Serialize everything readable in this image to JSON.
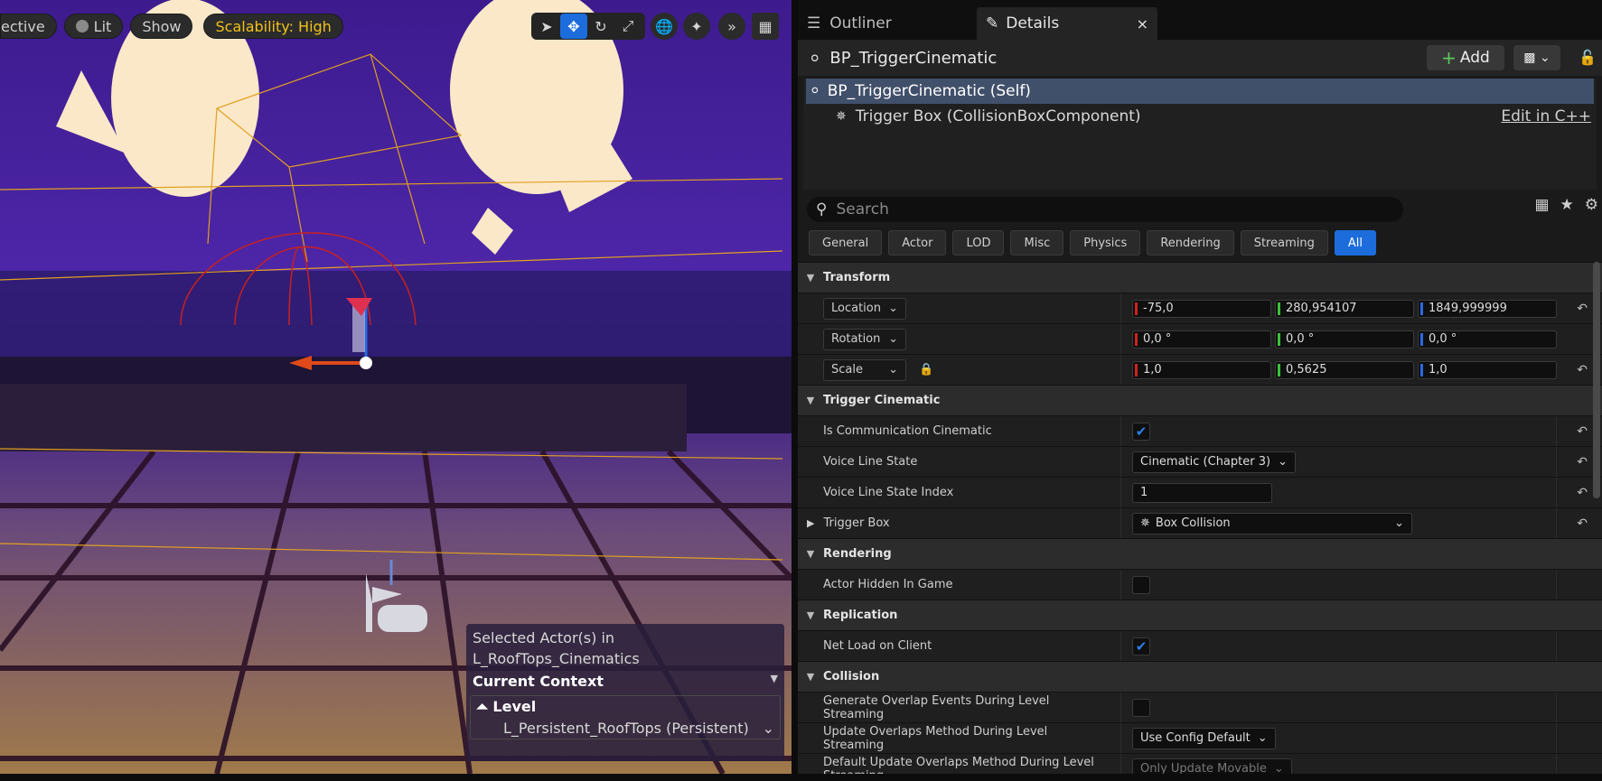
{
  "viewport": {
    "view_mode": "ective",
    "lit": "Lit",
    "show": "Show",
    "scalability": "Scalability: High",
    "tools": [
      "select-icon",
      "move-icon",
      "rotate-icon",
      "scale-icon"
    ],
    "context": {
      "selected_line1": "Selected Actor(s) in",
      "selected_line2": " L_RoofTops_Cinematics",
      "current_context": "Current Context",
      "level_label": "Level",
      "level_value": "L_Persistent_RoofTops (Persistent)"
    }
  },
  "tabs": {
    "outliner": "Outliner",
    "details": "Details"
  },
  "header": {
    "title": "BP_TriggerCinematic",
    "add_label": "Add"
  },
  "components": {
    "self": "BP_TriggerCinematic (Self)",
    "child": "Trigger Box (CollisionBoxComponent)",
    "edit_link": "Edit in C++"
  },
  "search": {
    "placeholder": "Search"
  },
  "filters": [
    "General",
    "Actor",
    "LOD",
    "Misc",
    "Physics",
    "Rendering",
    "Streaming",
    "All"
  ],
  "details": {
    "transform": {
      "title": "Transform",
      "location_label": "Location",
      "location": [
        "-75,0",
        "280,954107",
        "1849,999999"
      ],
      "rotation_label": "Rotation",
      "rotation": [
        "0,0 °",
        "0,0 °",
        "0,0 °"
      ],
      "scale_label": "Scale",
      "scale": [
        "1,0",
        "0,5625",
        "1,0"
      ]
    },
    "trigger_cinematic": {
      "title": "Trigger Cinematic",
      "is_comm_label": "Is Communication Cinematic",
      "is_comm_checked": true,
      "voice_state_label": "Voice Line State",
      "voice_state_value": "Cinematic (Chapter 3)",
      "voice_index_label": "Voice Line State Index",
      "voice_index_value": "1",
      "trigger_box_label": "Trigger Box",
      "trigger_box_value": "Box Collision"
    },
    "rendering": {
      "title": "Rendering",
      "hidden_label": "Actor Hidden In Game",
      "hidden_checked": false
    },
    "replication": {
      "title": "Replication",
      "net_load_label": "Net Load on Client",
      "net_load_checked": true
    },
    "collision": {
      "title": "Collision",
      "gen_overlap_label": "Generate Overlap Events During Level Streaming",
      "gen_overlap_checked": false,
      "update_method_label": "Update Overlaps Method During Level Streaming",
      "update_method_value": "Use Config Default",
      "default_method_label": "Default Update Overlaps Method During Level Streaming",
      "default_method_value": "Only Update Movable"
    }
  }
}
